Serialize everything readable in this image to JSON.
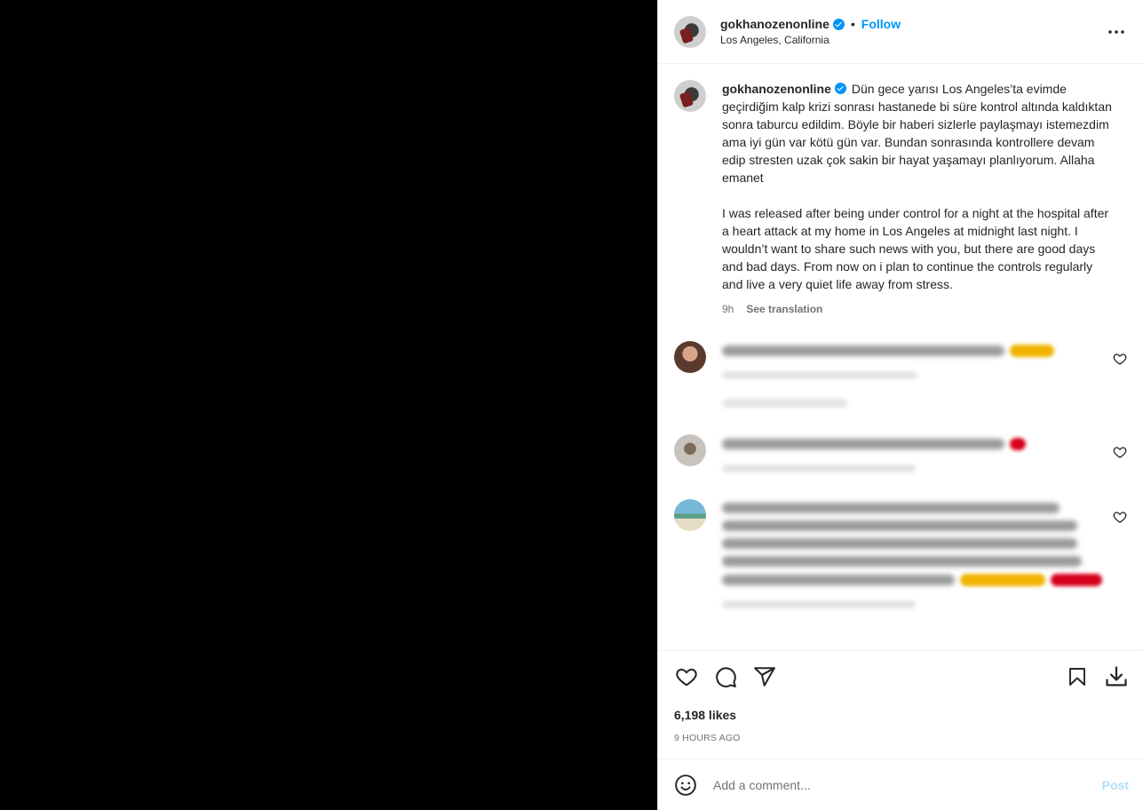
{
  "post": {
    "username": "gokhanozenonline",
    "separator": "•",
    "follow_label": "Follow",
    "location": "Los Angeles, California"
  },
  "caption": {
    "username": "gokhanozenonline",
    "text": "Dün gece yarısı Los Angeles’ta evimde geçirdiğim kalp krizi sonrası hastanede bi süre kontrol altında kaldıktan sonra taburcu edildim. Böyle bir haberi sizlerle paylaşmayı istemezdim ama iyi gün var kötü gün var. Bundan sonrasında kontrollere devam edip stresten uzak çok sakin bir hayat yaşamayı planlıyorum. Allaha emanet\n\nI was released after being under control for a night at the hospital after a heart attack at my home in Los Angeles at midnight last night. I wouldn’t want to share such news with you, but there are good days and bad days. From now on i plan to continue the controls regularly and live a very quiet life away from stress.",
    "age": "9h",
    "see_translation": "See translation"
  },
  "engagement": {
    "likes": "6,198 likes",
    "posted": "9 hours ago"
  },
  "composer": {
    "placeholder": "Add a comment...",
    "post_label": "Post"
  },
  "icons": {
    "more": "more-options-icon",
    "like": "heart-icon",
    "comment": "comment-icon",
    "share": "share-icon",
    "save": "bookmark-icon",
    "download": "download-icon",
    "emoji": "emoji-icon"
  },
  "colors": {
    "accent": "#0095f6",
    "post_disabled": "#b2dffc",
    "muted": "#737373"
  }
}
